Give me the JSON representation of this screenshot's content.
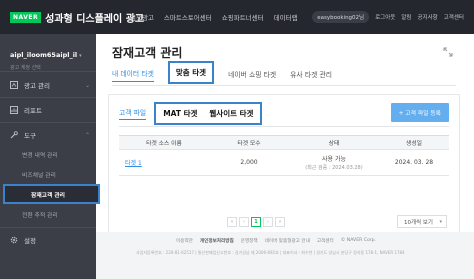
{
  "topbar": {
    "logo": "NAVER",
    "title": "성과형 디스플레이 광고",
    "nav": [
      "검색광고",
      "스마트스토어센터",
      "쇼핑파트너센터",
      "데이터랩"
    ],
    "user": "easybooking02님",
    "utils": [
      "로그아웃",
      "알림",
      "공지사항",
      "고객센터"
    ]
  },
  "sidebar": {
    "account_id": "aipl_iloom65aipl_il",
    "account_sub": "광고 계정 선택",
    "items": [
      {
        "label": "광고 관리",
        "icon": "ad-icon"
      },
      {
        "label": "리포트",
        "icon": "report-icon"
      },
      {
        "label": "도구",
        "icon": "tool-icon"
      }
    ],
    "subitems": [
      "변경 내역 관리",
      "비즈채널 관리",
      "잠재고객 관리",
      "전환 추적 관리"
    ],
    "settings": "설정"
  },
  "main": {
    "title": "잠재고객 관리",
    "tabs": [
      "내 데이터 타겟",
      "맞춤 타겟",
      "네이버 쇼핑 타겟",
      "유사 타겟 관리"
    ],
    "subtabs": [
      "고객 파일",
      "MAT 타겟",
      "웹사이트 타겟"
    ],
    "register_button": "+ 고객 파일 등록",
    "table": {
      "headers": [
        "타겟 소스 이름",
        "타겟 모수",
        "상태",
        "생성일"
      ],
      "rows": [
        {
          "name": "타겟 1",
          "count": "2,000",
          "status": "사용 가능",
          "status_sub": "(최근 검증 : 2024.03.28)",
          "date": "2024. 03. 28"
        }
      ]
    },
    "pager": {
      "current": "1"
    },
    "per_page": "10개씩 보기"
  },
  "footer": {
    "links": [
      "이용약관",
      "개인정보처리방침",
      "운영정책",
      "네이버 맞춤형광고 안내",
      "고객센터",
      "© NAVER Corp."
    ],
    "info": "사업자등록번호 : 220-81-62517 | 통신판매업신고번호 : 경기성남 제 2006-692호 | 대표이사 : 최수연 | 경기도 성남시 분당구 정자동 178-1, NAVER 1784"
  }
}
